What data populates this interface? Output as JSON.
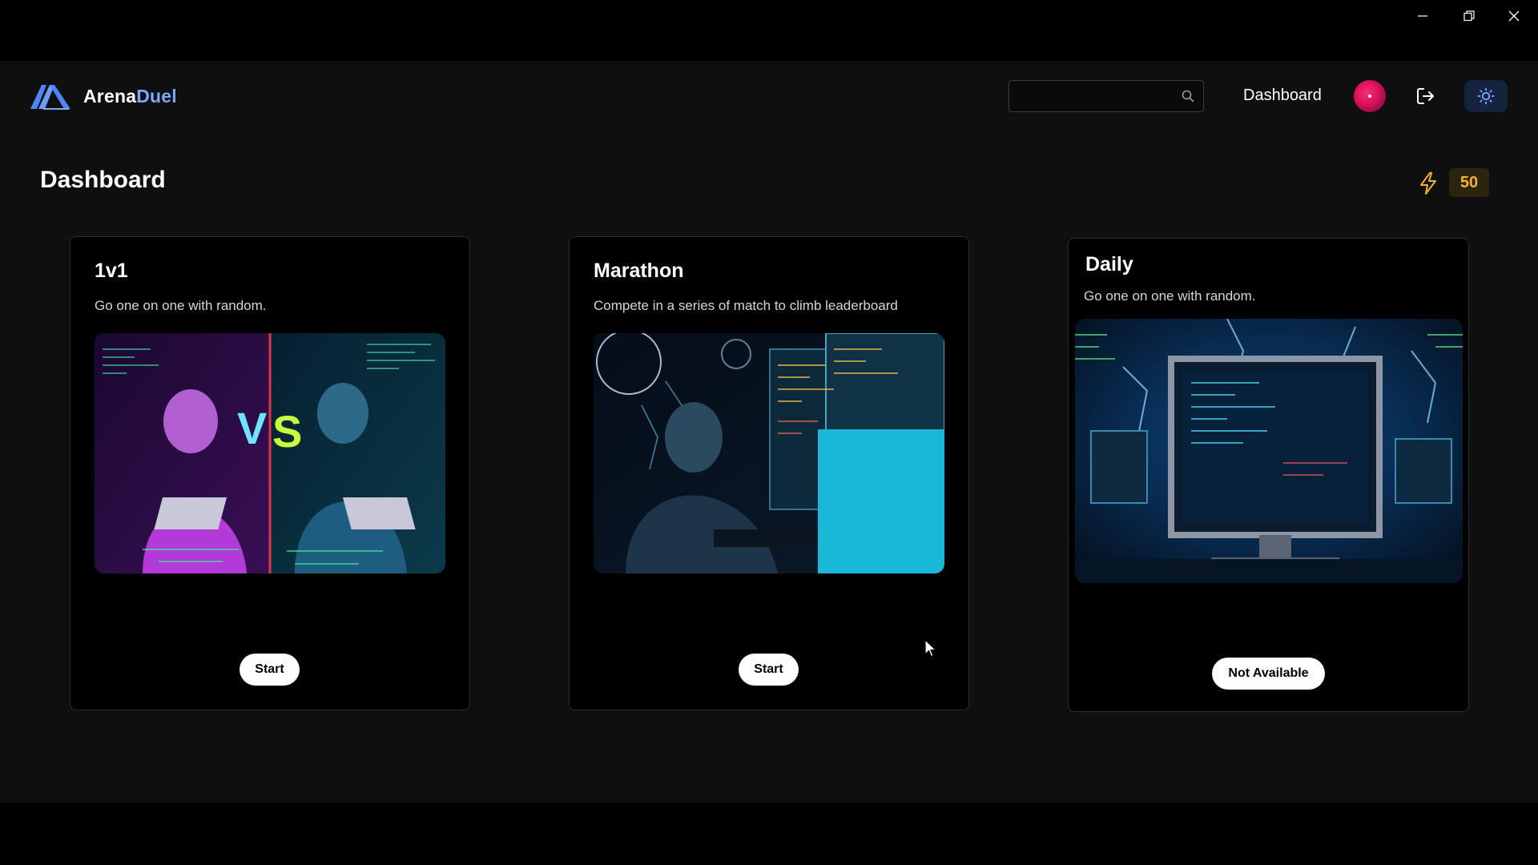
{
  "window": {
    "controls": [
      "minimize-icon",
      "restore-icon",
      "close-icon"
    ]
  },
  "header": {
    "logo_part1": "Arena",
    "logo_part2": "Duel",
    "search_placeholder": "",
    "search_value": "",
    "nav_dashboard": "Dashboard",
    "icons": [
      "search-icon",
      "logout-icon",
      "sun-icon"
    ]
  },
  "page": {
    "title": "Dashboard",
    "energy_count": "50"
  },
  "cards": [
    {
      "title": "1v1",
      "description": "Go one on one with random.",
      "button": "Start"
    },
    {
      "title": "Marathon",
      "description": "Compete in a series of match to climb leaderboard",
      "button": "Start"
    },
    {
      "title": "Daily",
      "description": "Go one on one with random.",
      "button": "Not Available"
    }
  ],
  "colors": {
    "accent_blue": "#7aa8ff",
    "energy": "#f5b52a",
    "avatar": "#d8105a",
    "card_bg": "#000000",
    "page_bg": "#0f0f0f"
  }
}
